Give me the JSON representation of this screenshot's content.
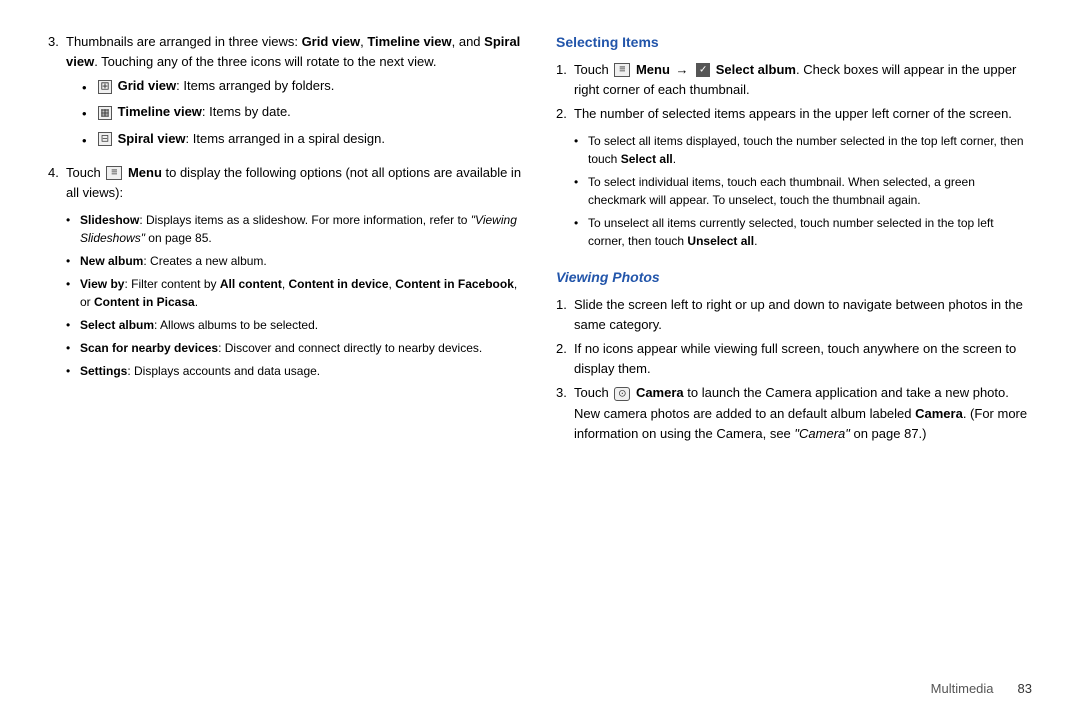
{
  "page": {
    "footer": {
      "section": "Multimedia",
      "page_number": "83"
    }
  },
  "left_column": {
    "intro": {
      "num": "3.",
      "text_parts": [
        "Thumbnails are arranged in three views: ",
        "Grid view",
        ", ",
        "Timeline view",
        ", and ",
        "Spiral view",
        ". Touching any of the three icons will rotate to the next view."
      ]
    },
    "view_items": [
      {
        "bold": "Grid view",
        "text": ": Items arranged by folders."
      },
      {
        "bold": "Timeline view",
        "text": ": Items by date."
      },
      {
        "bold": "Spiral view",
        "text": ": Items arranged in a spiral design."
      }
    ],
    "menu_item": {
      "num": "4.",
      "text_start": "Touch ",
      "menu_label": "Menu",
      "text_end": " to display the following options (not all options are available in all views):"
    },
    "menu_bullets": [
      {
        "bold": "Slideshow",
        "text": ": Displays items as a slideshow. For more information, refer to ",
        "italic": "\"Viewing Slideshows\"",
        "text2": " on page 85."
      },
      {
        "bold": "New album",
        "text": ": Creates a new album."
      },
      {
        "bold": "View by",
        "text": ": Filter content by ",
        "bold2": "All content",
        "text2": ", ",
        "bold3": "Content in device",
        "text3": ", ",
        "bold4": "Content in Facebook",
        "text4": ", or ",
        "bold5": "Content in Picasa",
        "text5": "."
      },
      {
        "bold": "Select album",
        "text": ": Allows albums to be selected."
      },
      {
        "bold": "Scan for nearby devices",
        "text": ": Discover and connect directly to nearby devices."
      },
      {
        "bold": "Settings",
        "text": ": Displays accounts and data usage."
      }
    ]
  },
  "right_column": {
    "selecting_items": {
      "title": "Selecting Items",
      "items": [
        {
          "num": "1.",
          "text_start": "Touch ",
          "menu_label": "Menu",
          "arrow": "→",
          "text_middle": " Select album",
          "text_end": ". Check boxes will appear in the upper right corner of each thumbnail."
        },
        {
          "num": "2.",
          "text": "The number of selected items appears in the upper left corner of the screen."
        }
      ],
      "sub_bullets": [
        "To select all items displayed, touch the number selected in the top left corner, then touch ",
        "To select individual items, touch each thumbnail. When selected, a green checkmark will appear. To unselect, touch the thumbnail again.",
        "To unselect all items currently selected, touch number selected in the top left corner, then touch "
      ],
      "select_all_label": "Select all",
      "unselect_all_label": "Unselect all"
    },
    "viewing_photos": {
      "title": "Viewing Photos",
      "items": [
        {
          "num": "1.",
          "text": "Slide the screen left to right or up and down to navigate between photos in the same category."
        },
        {
          "num": "2.",
          "text": "If no icons appear while viewing full screen, touch anywhere on the screen to display them."
        },
        {
          "num": "3.",
          "text_start": "Touch ",
          "camera_label": "Camera",
          "text_end": " to launch the Camera application and take a new photo. New camera photos are added to an default album labeled ",
          "camera_label2": "Camera",
          "text_end2": ". (For more information on using the Camera, see ",
          "italic": "\"Camera\"",
          "text_end3": " on page 87.)"
        }
      ]
    }
  }
}
